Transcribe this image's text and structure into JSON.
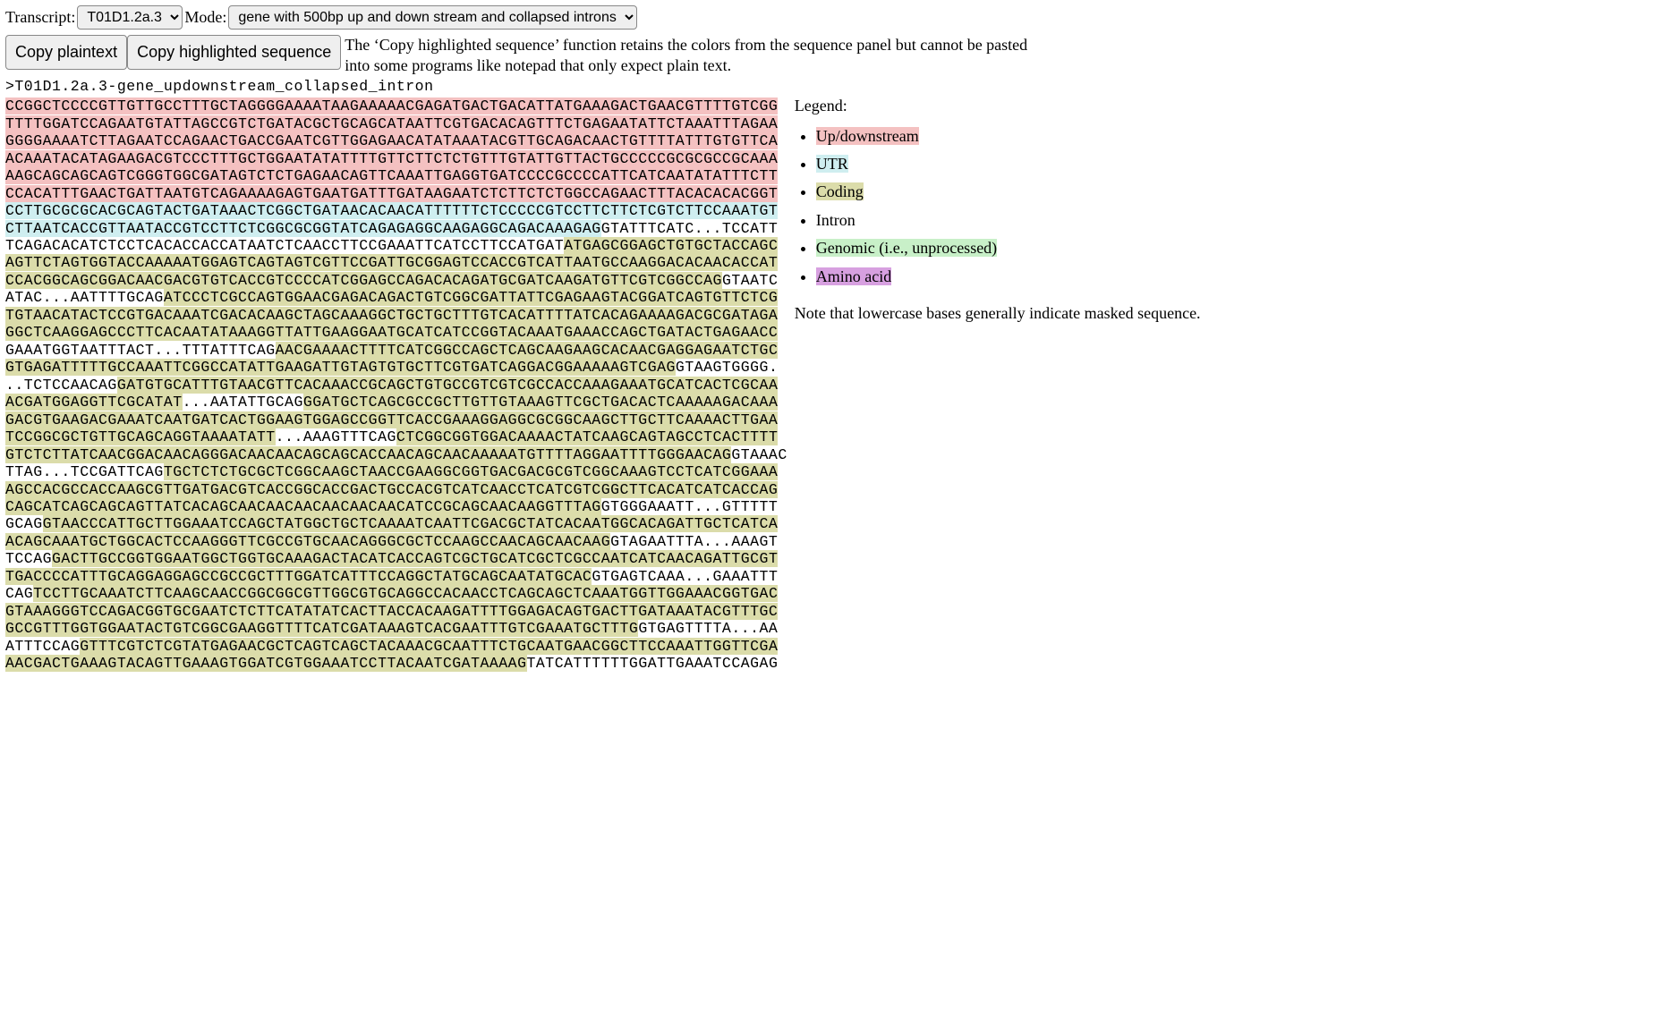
{
  "controls": {
    "transcript_label": "Transcript:",
    "transcript_value": "T01D1.2a.3",
    "mode_label": "Mode:",
    "mode_value": "gene with 500bp up and down stream and collapsed introns"
  },
  "buttons": {
    "copy_plain": "Copy plaintext",
    "copy_hl": "Copy highlighted sequence"
  },
  "note": "The ‘Copy highlighted sequence’ function retains the colors from the sequence panel but cannot be pasted into some programs like notepad that only expect plain text.",
  "seq_header": ">T01D1.2a.3-gene_updownstream_collapsed_intron",
  "legend": {
    "title": "Legend:",
    "items": [
      {
        "label": "Up/downstream",
        "cls": "hl-up"
      },
      {
        "label": "UTR",
        "cls": "hl-utr"
      },
      {
        "label": "Coding",
        "cls": "hl-cds"
      },
      {
        "label": "Intron",
        "cls": "plain"
      },
      {
        "label": "Genomic (i.e., unprocessed)",
        "cls": "hl-gen"
      },
      {
        "label": "Amino acid",
        "cls": "hl-aa"
      }
    ],
    "footer": "Note that lowercase bases generally indicate masked sequence."
  },
  "sequence_lines": [
    [
      {
        "cls": "hl-up",
        "t": "CCGGCTCCCCGTTGTTGCCTTTGCTAGGGGAAAATAAGAAAAACGAGATGACTGACATTATGAAAGACTGAACGTTTTGTCGG"
      }
    ],
    [
      {
        "cls": "hl-up",
        "t": "TTTTGGATCCAGAATGTATTAGCCGTCTGATACGCTGCAGCATAATTCGTGACACAGTTTCTGAGAATATTCTAAATTTAGAA"
      }
    ],
    [
      {
        "cls": "hl-up",
        "t": "GGGGAAAATCTTAGAATCCAGAACTGACCGAATCGTTGGAGAACATATAAATACGTTGCAGACAACTGTTTTATTTGTGTTCA"
      }
    ],
    [
      {
        "cls": "hl-up",
        "t": "ACAAATACATAGAAGACGTCCCTTTGCTGGAATATATTTTGTTCTTCTCTGTTTGTATTGTTACTGCCCCCGCGCGCCGCAAA"
      }
    ],
    [
      {
        "cls": "hl-up",
        "t": "AAGCAGCAGCAGTCGGGTGGCGATAGTCTCTGAGAACAGTTCAAATTGAGGTGATCCCCGCCCCATTCATCAATATATTTCTT"
      }
    ],
    [
      {
        "cls": "hl-up",
        "t": "CCACATTTGAACTGATTAATGTCAGAAAAGAGTGAATGATTTGATAAGAATCTCTTCTCTGGCCAGAACTTTACACACACGGT"
      }
    ],
    [
      {
        "cls": "hl-utr",
        "t": "CCTTGCGCGCACGCAGTACTGATAAACTCGGCTGATAACACAACATTTTTTCTCCCCCGTCCTTCTTCTCGTCTTCCAAATGT"
      }
    ],
    [
      {
        "cls": "hl-utr",
        "t": "CTTAATCACCGTTAATACCGTCCTTCTCGGCGCGGTATCAGAGAGGCAAGAGGCAGACAAAGAG"
      },
      {
        "cls": "plain",
        "t": "GTATTTCATC...TCCATT"
      }
    ],
    [
      {
        "cls": "plain",
        "t": "TCAGACACATCTCCTCACACCACCATAATCTCAACCTTCCGAAATTCATCCTTCCATGAT"
      },
      {
        "cls": "hl-cds",
        "t": "ATGAGCGGAGCTGTGCTACCAGC"
      }
    ],
    [
      {
        "cls": "hl-cds",
        "t": "AGTTCTAGTGGTACCAAAAATGGAGTCAGTAGTCGTTCCGATTGCGGAGTCCACCGTCATTAATGCCAAGGACACAACACCAT"
      }
    ],
    [
      {
        "cls": "hl-cds",
        "t": "CCACGGCAGCGGACAACGACGTGTCACCGTCCCCATCGGAGCCAGACACAGATGCGATCAAGATGTTCGTCGGCCAG"
      },
      {
        "cls": "plain",
        "t": "GTAATC"
      }
    ],
    [
      {
        "cls": "plain",
        "t": "ATAC...AATTTTGCAG"
      },
      {
        "cls": "hl-cds",
        "t": "ATCCCTCGCCAGTGGAACGAGACAGACTGTCGGCGATTATTCGAGAAGTACGGATCAGTGTTCTCG"
      }
    ],
    [
      {
        "cls": "hl-cds",
        "t": "TGTAACATACTCCGTGACAAATCGACACAAGCTAGCAAAGGCTGCTGCTTTGTCACATTTTATCACAGAAAAGACGCGATAGA"
      }
    ],
    [
      {
        "cls": "hl-cds",
        "t": "GGCTCAAGGAGCCCTTCACAATATAAAGGTTATTGAAGGAATGCATCATCCGGTACAAATGAAACCAGCTGATACTGAGAACC"
      }
    ],
    [
      {
        "cls": "plain",
        "t": "GAAATGGTAATTTACT...TTTATTTCAG"
      },
      {
        "cls": "hl-cds",
        "t": "AACGAAAACTTTTCATCGGCCAGCTCAGCAAGAAGCACAACGAGGAGAATCTGC"
      }
    ],
    [
      {
        "cls": "hl-cds",
        "t": "GTGAGATTTTTGCCAAATTCGGCCATATTGAAGATTGTAGTGTGCTTCGTGATCAGGACGGAAAAAGTCGAG"
      },
      {
        "cls": "plain",
        "t": "GTAAGTGGGG."
      }
    ],
    [
      {
        "cls": "plain",
        "t": "..TCTCCAACAG"
      },
      {
        "cls": "hl-cds",
        "t": "GATGTGCATTTGTAACGTTCACAAACCGCAGCTGTGCCGTCGTCGCCACCAAAGAAATGCATCACTCGCAA"
      }
    ],
    [
      {
        "cls": "hl-cds",
        "t": "ACGATGGAGGTTCGCATAT"
      },
      {
        "cls": "plain",
        "t": "...AATATTGCAG"
      },
      {
        "cls": "hl-cds",
        "t": "GGATGCTCAGCGCCGCTTGTTGTAAAGTTCGCTGACACTCAAAAAGACAAA"
      }
    ],
    [
      {
        "cls": "hl-cds",
        "t": "GACGTGAAGACGAAATCAATGATCACTGGAAGTGGAGCCGGTTCACCGAAAGGAGGCGCGGCAAGCTTGCTTCAAAACTTGAA"
      }
    ],
    [
      {
        "cls": "hl-cds",
        "t": "TCCGGCGCTGTTGCAGCAGGTAAAATATT"
      },
      {
        "cls": "plain",
        "t": "...AAAGTTTCAG"
      },
      {
        "cls": "hl-cds",
        "t": "CTCGGCGGTGGACAAAACTATCAAGCAGTAGCCTCACTTTT"
      }
    ],
    [
      {
        "cls": "hl-cds",
        "t": "GTCTCTTATCAACGGACAACAGGGACAACAACAGCAGCACCAACAGCAACAAAAATGTTTTAGGAATTTTGGGAACAG"
      },
      {
        "cls": "plain",
        "t": "GTAAAC"
      }
    ],
    [
      {
        "cls": "plain",
        "t": "TTAG...TCCGATTCAG"
      },
      {
        "cls": "hl-cds",
        "t": "TGCTCTCTGCGCTCGGCAAGCTAACCGAAGGCGGTGACGACGCGTCGGCAAAGTCCTCATCGGAAA"
      }
    ],
    [
      {
        "cls": "hl-cds",
        "t": "AGCCACGCCACCAAGCGTTGATGACGTCACCGGCACCGACTGCCACGTCATCAACCTCATCGTCGGCTTCACATCATCACCAG"
      }
    ],
    [
      {
        "cls": "hl-cds",
        "t": "CAGCATCAGCAGCAGTTATCACAGCAACAACAACAACAACAACATCCGCAGCAACAAGGTTTAG"
      },
      {
        "cls": "plain",
        "t": "GTGGGAAATT...GTTTTT"
      }
    ],
    [
      {
        "cls": "plain",
        "t": "GCAG"
      },
      {
        "cls": "hl-cds",
        "t": "GTAACCCATTGCTTGGAAATCCAGCTATGGCTGCTCAAAATCAATTCGACGCTATCACAATGGCACAGATTGCTCATCA"
      }
    ],
    [
      {
        "cls": "hl-cds",
        "t": "ACAGCAAATGCTGGCACTCCAAGGGTTCGCCGTGCAACAGGGCGCTCCAAGCCAACAGCAACAAG"
      },
      {
        "cls": "plain",
        "t": "GTAGAATTTA...AAAGT"
      }
    ],
    [
      {
        "cls": "plain",
        "t": "TCCAG"
      },
      {
        "cls": "hl-cds",
        "t": "GACTTGCCGGTGGAATGGCTGGTGCAAAGACTACATCACCAGTCGCTGCATCGCTCGCCAATCATCAACAGATTGCGT"
      }
    ],
    [
      {
        "cls": "hl-cds",
        "t": "TGACCCCATTTGCAGGAGGAGCCGCCGCTTTGGATCATTTCCAGGCTATGCAGCAATATGCAC"
      },
      {
        "cls": "plain",
        "t": "GTGAGTCAAA...GAAATTT"
      }
    ],
    [
      {
        "cls": "plain",
        "t": "CAG"
      },
      {
        "cls": "hl-cds",
        "t": "TCCTTGCAAATCTTCAAGCAACCGGCGGCGTTGGCGTGCAGGCCACAACCTCAGCAGCTCAAATGGTTGGAAACGGTGAC"
      }
    ],
    [
      {
        "cls": "hl-cds",
        "t": "GTAAAGGGTCCAGACGGTGCGAATCTCTTCATATATCACTTACCACAAGATTTTGGAGACAGTGACTTGATAAATACGTTTGC"
      }
    ],
    [
      {
        "cls": "hl-cds",
        "t": "GCCGTTTGGTGGAATACTGTCGGCGAAGGTTTTCATCGATAAAGTCACGAATTTGTCGAAATGCTTTG"
      },
      {
        "cls": "plain",
        "t": "GTGAGTTTTA...AA"
      }
    ],
    [
      {
        "cls": "plain",
        "t": "ATTTCCAG"
      },
      {
        "cls": "hl-cds",
        "t": "GTTTCGTCTCGTATGAGAACGCTCAGTCAGCTACAAACGCAATTTCTGCAATGAACGGCTTCCAAATTGGTTCGA"
      }
    ],
    [
      {
        "cls": "hl-cds",
        "t": "AACGACTGAAAGTACAGTTGAAAGTGGATCGTGGAAATCCTTACAATCGATAAAAG"
      },
      {
        "cls": "plain",
        "t": "TATCATTTTTTGGATTGAAATCCAGAG"
      }
    ]
  ]
}
